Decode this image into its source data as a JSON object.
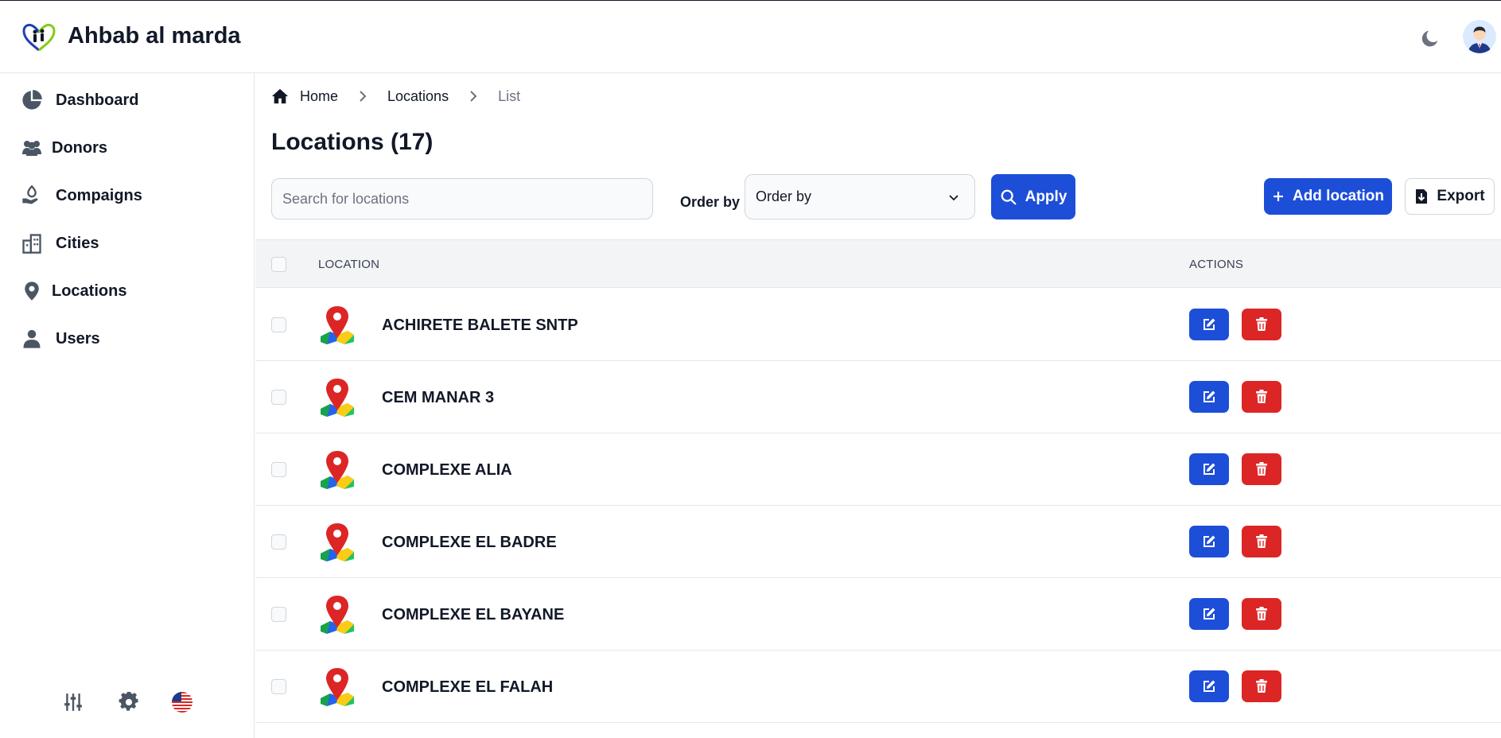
{
  "app": {
    "title": "Ahbab al marda"
  },
  "sidebar": {
    "items": [
      {
        "label": "Dashboard",
        "icon": "pie-chart-icon"
      },
      {
        "label": "Donors",
        "icon": "users-group-icon"
      },
      {
        "label": "Compaigns",
        "icon": "hand-donation-icon"
      },
      {
        "label": "Cities",
        "icon": "city-buildings-icon"
      },
      {
        "label": "Locations",
        "icon": "map-pin-icon"
      },
      {
        "label": "Users",
        "icon": "user-icon"
      }
    ],
    "tools": [
      "sliders-icon",
      "gear-icon",
      "us-flag-icon"
    ]
  },
  "breadcrumb": {
    "home": "Home",
    "section": "Locations",
    "current": "List"
  },
  "page": {
    "title": "Locations (17)"
  },
  "toolbar": {
    "search_placeholder": "Search for locations",
    "order_label": "Order by",
    "order_value": "Order by",
    "apply_label": "Apply",
    "add_label": "Add location",
    "export_label": "Export"
  },
  "table": {
    "columns": {
      "location": "LOCATION",
      "actions": "ACTIONS"
    },
    "rows": [
      {
        "name": "ACHIRETE BALETE SNTP"
      },
      {
        "name": "CEM MANAR 3"
      },
      {
        "name": "COMPLEXE ALIA"
      },
      {
        "name": "COMPLEXE EL BADRE"
      },
      {
        "name": "COMPLEXE EL BAYANE"
      },
      {
        "name": "COMPLEXE EL FALAH"
      }
    ]
  },
  "colors": {
    "primary": "#1d4ed8",
    "danger": "#dc2626",
    "muted": "#6b7280",
    "border": "#e5e7eb"
  }
}
